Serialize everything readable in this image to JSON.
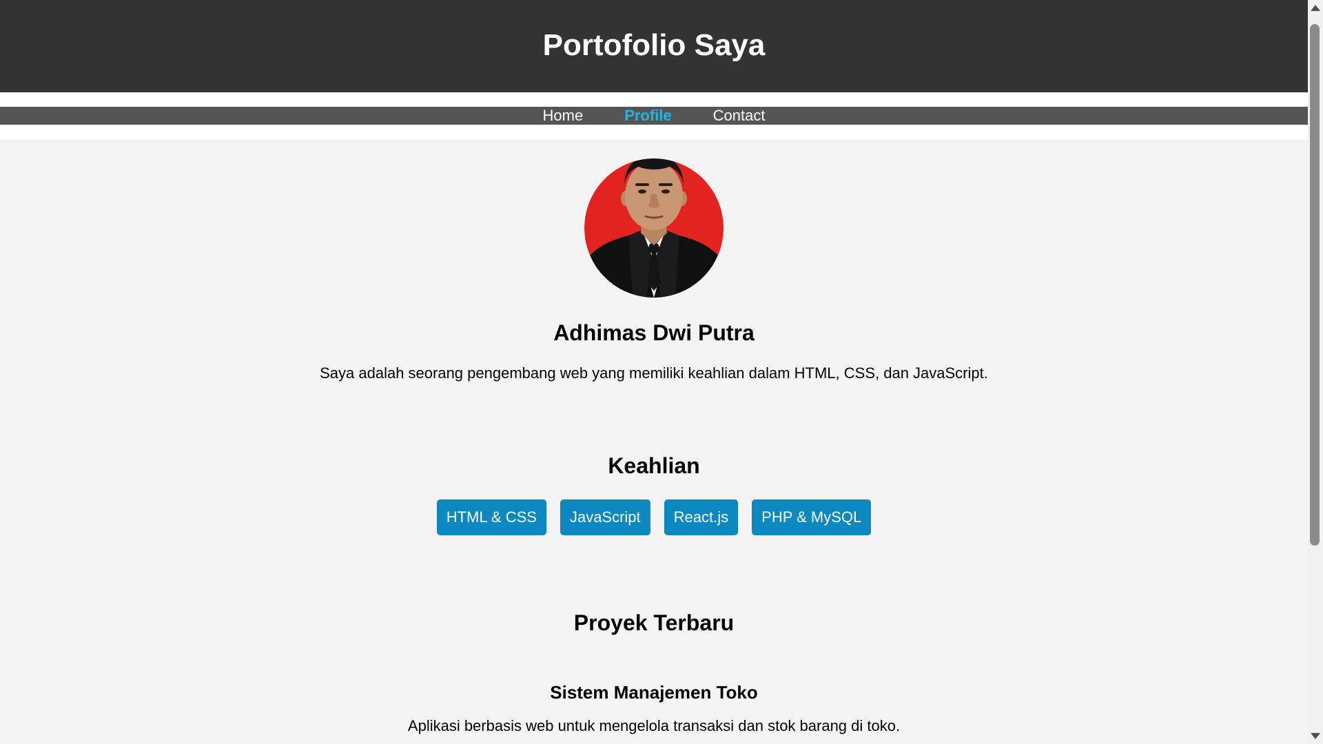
{
  "header": {
    "title": "Portofolio Saya"
  },
  "nav": {
    "items": [
      {
        "label": "Home",
        "active": false
      },
      {
        "label": "Profile",
        "active": true
      },
      {
        "label": "Contact",
        "active": false
      }
    ],
    "active_color": "#1fb3e6"
  },
  "profile": {
    "photo_icon": "profile-photo",
    "name": "Adhimas Dwi Putra",
    "bio": "Saya adalah seorang pengembang web yang memiliki keahlian dalam HTML, CSS, dan JavaScript."
  },
  "skills": {
    "title": "Keahlian",
    "items": [
      "HTML & CSS",
      "JavaScript",
      "React.js",
      "PHP & MySQL"
    ],
    "badge_color": "#0a88bf"
  },
  "projects": {
    "title": "Proyek Terbaru",
    "items": [
      {
        "name": "Sistem Manajemen Toko",
        "description": "Aplikasi berbasis web untuk mengelola transaksi dan stok barang di toko."
      }
    ]
  },
  "colors": {
    "header_bg": "#333333",
    "nav_bg": "#555555",
    "page_bg": "#f3f3f3"
  }
}
